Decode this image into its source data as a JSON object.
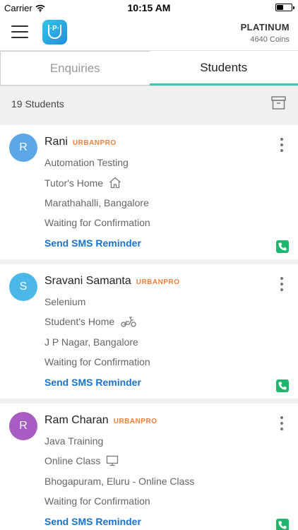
{
  "status_bar": {
    "carrier": "Carrier",
    "time": "10:15 AM"
  },
  "header": {
    "plan_title": "PLATINUM",
    "plan_coins": "4640 Coins"
  },
  "tabs": [
    {
      "label": "Enquiries",
      "active": false
    },
    {
      "label": "Students",
      "active": true
    }
  ],
  "student_count": "19 Students",
  "students": [
    {
      "initial": "R",
      "avatar_color": "#5ba7e8",
      "name": "Rani",
      "badge": "URBANPRO",
      "course": "Automation Testing",
      "mode": "Tutor's Home",
      "mode_icon": "home-icon",
      "location": "Marathahalli, Bangalore",
      "status": "Waiting for Confirmation",
      "action": "Send SMS Reminder"
    },
    {
      "initial": "S",
      "avatar_color": "#4cb8e8",
      "name": "Sravani Samanta",
      "badge": "URBANPRO",
      "course": "Selenium",
      "mode": "Student's Home",
      "mode_icon": "scooter-icon",
      "location": "J P Nagar, Bangalore",
      "status": "Waiting for Confirmation",
      "action": "Send SMS Reminder"
    },
    {
      "initial": "R",
      "avatar_color": "#a85bc2",
      "name": "Ram Charan",
      "badge": "URBANPRO",
      "course": "Java Training",
      "mode": "Online Class",
      "mode_icon": "monitor-icon",
      "location": "Bhogapuram, Eluru - Online Class",
      "status": "Waiting for Confirmation",
      "action": "Send SMS Reminder"
    }
  ],
  "colors": {
    "accent": "#3dc7b0",
    "link": "#1a73c8",
    "badge": "#f07f3c",
    "call": "#1fb56c"
  }
}
